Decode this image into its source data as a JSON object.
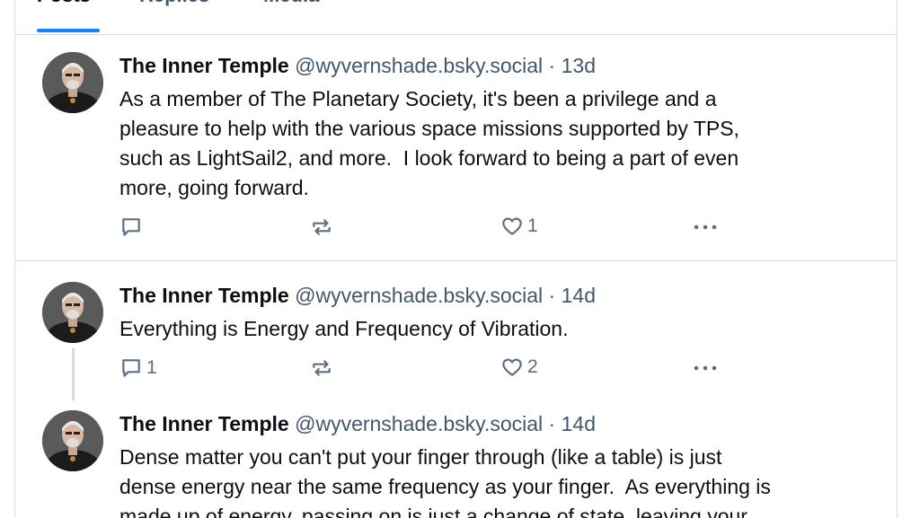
{
  "tabs": [
    {
      "label": "Posts",
      "active": true
    },
    {
      "label": "Replies",
      "active": false
    },
    {
      "label": "Media",
      "active": false
    }
  ],
  "colors": {
    "accent": "#1083fe",
    "text": "#0b0f14",
    "muted": "#42576c",
    "border": "#d4dbe2"
  },
  "posts": [
    {
      "author": "The Inner Temple",
      "handle": "@wyvernshade.bsky.social",
      "time": "13d",
      "text": "As a member of The Planetary Society, it's been a privilege and a\npleasure to help with the various space missions supported by TPS,\nsuch as LightSail2, and more.  I look forward to being a part of even\nmore, going forward.",
      "replies": "",
      "reposts": "",
      "likes": "1"
    },
    {
      "author": "The Inner Temple",
      "handle": "@wyvernshade.bsky.social",
      "time": "14d",
      "text": "Everything is Energy and Frequency of Vibration.",
      "replies": "1",
      "reposts": "",
      "likes": "2"
    },
    {
      "author": "The Inner Temple",
      "handle": "@wyvernshade.bsky.social",
      "time": "14d",
      "text": "Dense matter you can't put your finger through (like a table) is just\ndense energy near the same frequency as your finger.  As everything is\nmade up of energy, passing on is just a change of state, leaving your"
    }
  ],
  "icons": {
    "reply": "comment-icon",
    "repost": "repost-icon",
    "like": "heart-icon",
    "more": "ellipsis-icon"
  }
}
